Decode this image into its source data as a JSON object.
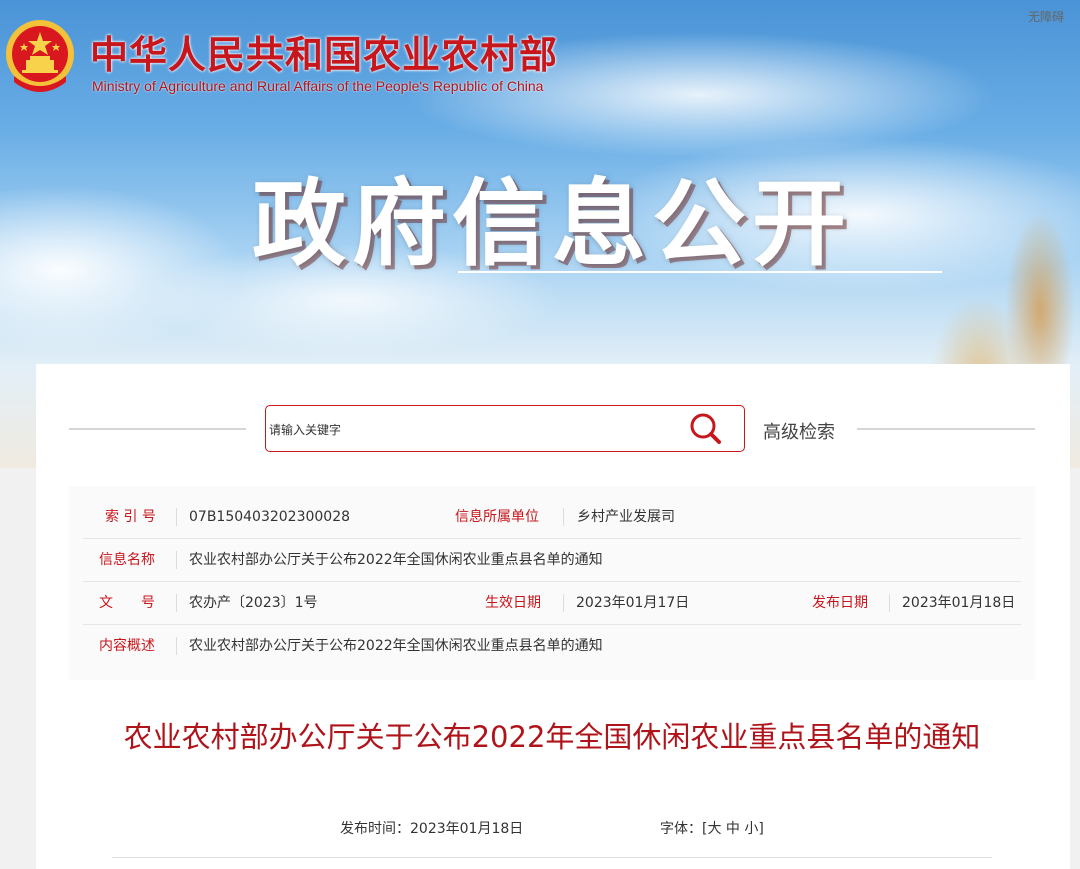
{
  "header": {
    "ministry_name_cn": "中华人民共和国农业农村部",
    "ministry_name_en": "Ministry of Agriculture and Rural Affairs of the People's Republic of China",
    "accessibility_link": "无障碍",
    "section_title": "政府信息公开"
  },
  "search": {
    "placeholder": "请输入关键字",
    "advanced_label": "高级检索"
  },
  "info": {
    "index_label": "索 引 号",
    "index_value": "07B150403202300028",
    "dept_label": "信息所属单位",
    "dept_value": "乡村产业发展司",
    "name_label": "信息名称",
    "name_value": "农业农村部办公厅关于公布2022年全国休闲农业重点县名单的通知",
    "docno_label": "文　　号",
    "docno_value": "农办产〔2023〕1号",
    "effective_label": "生效日期",
    "effective_value": "2023年01月17日",
    "publish_label": "发布日期",
    "publish_value": "2023年01月18日",
    "summary_label": "内容概述",
    "summary_value": "农业农村部办公厅关于公布2022年全国休闲农业重点县名单的通知"
  },
  "article": {
    "title": "农业农村部办公厅关于公布2022年全国休闲农业重点县名单的通知",
    "publish_time_label": "发布时间：",
    "publish_time_value": "2023年01月18日",
    "font_label": "字体：",
    "font_open": "[",
    "font_large": "大",
    "font_medium": "中",
    "font_small": "小",
    "font_close": "]"
  },
  "colors": {
    "brand_red": "#c8161d",
    "title_red": "#b0141b"
  }
}
